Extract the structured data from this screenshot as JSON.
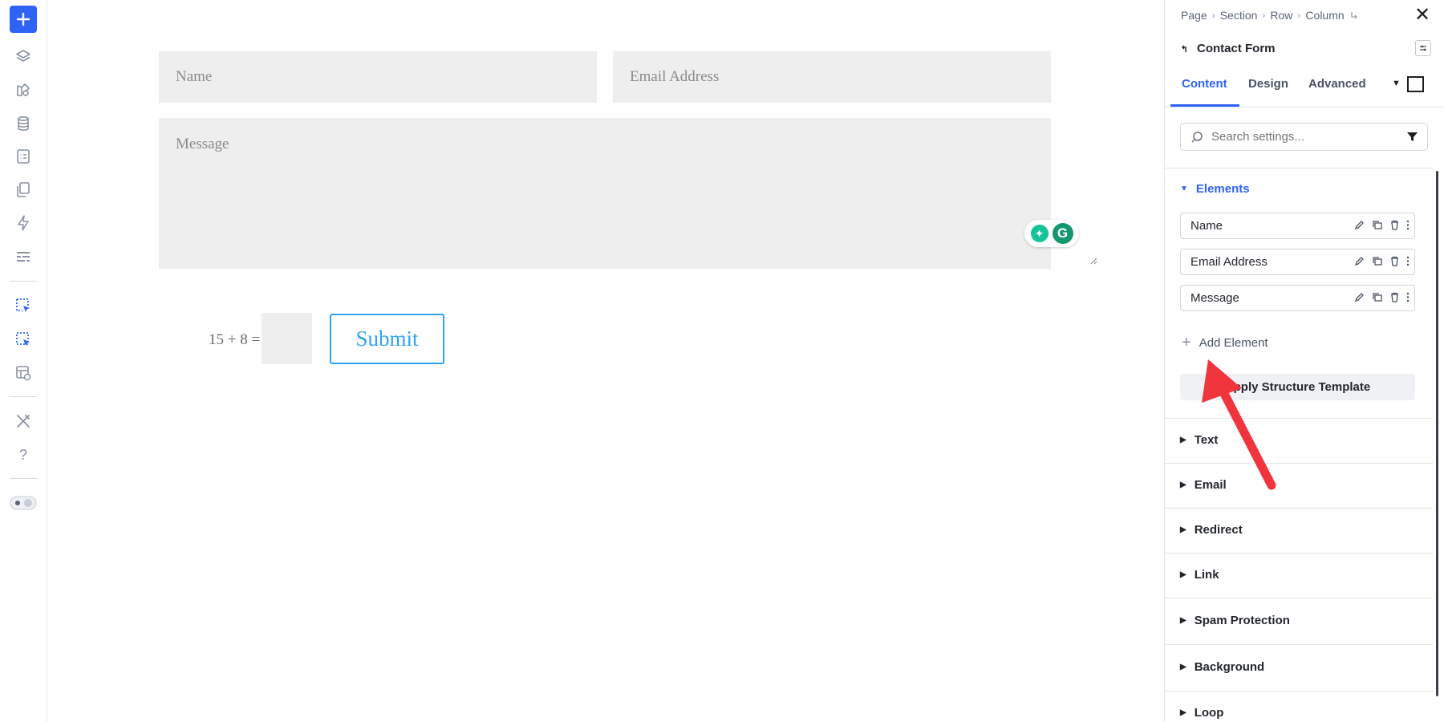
{
  "left_toolbar": {
    "icons": [
      "plus-icon",
      "layers-icon",
      "modules-icon",
      "database-icon",
      "form-icon",
      "pages-icon",
      "lightning-icon",
      "list-icon",
      "select-cursor-icon",
      "select-cursor-alt-icon",
      "layout-view-icon",
      "tools-icon",
      "help-icon",
      "theme-toggle-icon"
    ],
    "help_label": "?"
  },
  "form": {
    "name_placeholder": "Name",
    "email_placeholder": "Email Address",
    "message_placeholder": "Message",
    "captcha_question": "15 + 8 =",
    "submit_label": "Submit"
  },
  "panel": {
    "breadcrumb": [
      "Page",
      "Section",
      "Row",
      "Column"
    ],
    "breadcrumb_sep": "›",
    "module_title": "Contact Form",
    "tabs": [
      "Content",
      "Design",
      "Advanced"
    ],
    "active_tab": "Content",
    "search_placeholder": "Search settings...",
    "elements_section": "Elements",
    "elements": [
      "Name",
      "Email Address",
      "Message"
    ],
    "add_element_label": "Add Element",
    "apply_template_label": "Apply Structure Template",
    "sections": [
      "Text",
      "Email",
      "Redirect",
      "Link",
      "Spam Protection",
      "Background",
      "Loop"
    ]
  },
  "colors": {
    "accent": "#2f63f5",
    "submit": "#2ea3f2",
    "field_bg": "#eeeeee",
    "arrow": "#f0353d"
  }
}
